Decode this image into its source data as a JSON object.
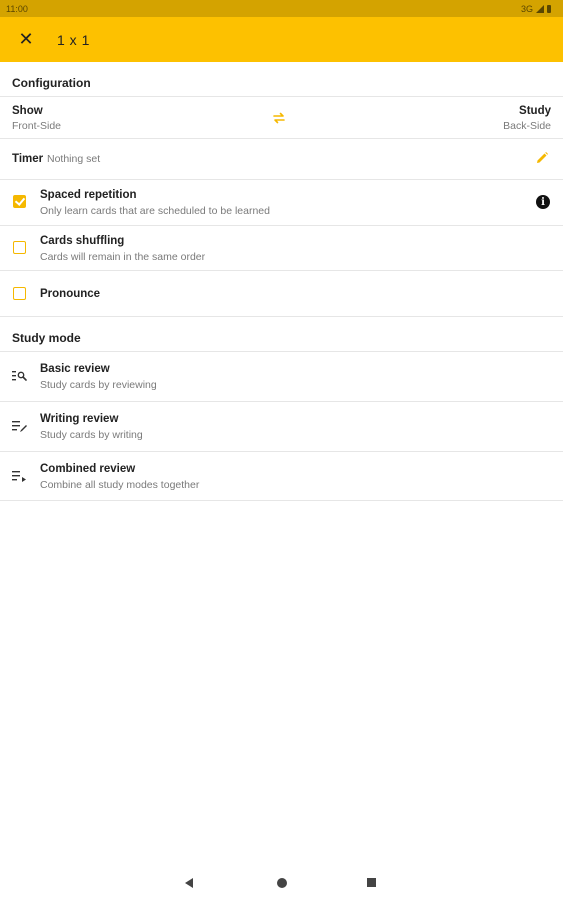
{
  "status_bar": {
    "time": "11:00",
    "network": "3G"
  },
  "app_bar": {
    "title": "1 x 1"
  },
  "configuration": {
    "header": "Configuration",
    "show": {
      "label": "Show",
      "value": "Front-Side"
    },
    "study": {
      "label": "Study",
      "value": "Back-Side"
    },
    "timer": {
      "label": "Timer",
      "value": "Nothing set"
    },
    "spaced_repetition": {
      "title": "Spaced repetition",
      "subtitle": "Only learn cards that are scheduled to be learned",
      "checked": true
    },
    "cards_shuffling": {
      "title": "Cards shuffling",
      "subtitle": "Cards will remain in the same order",
      "checked": false
    },
    "pronounce": {
      "title": "Pronounce",
      "checked": false
    }
  },
  "study_mode": {
    "header": "Study mode",
    "items": [
      {
        "title": "Basic review",
        "subtitle": "Study cards by reviewing",
        "icon": "basic-review-icon"
      },
      {
        "title": "Writing review",
        "subtitle": "Study cards by writing",
        "icon": "writing-review-icon"
      },
      {
        "title": "Combined review",
        "subtitle": "Combine all study modes together",
        "icon": "combined-review-icon"
      }
    ]
  },
  "colors": {
    "accent": "#fdc100",
    "status_bar": "#d4a300",
    "checkbox": "#f5b800"
  }
}
